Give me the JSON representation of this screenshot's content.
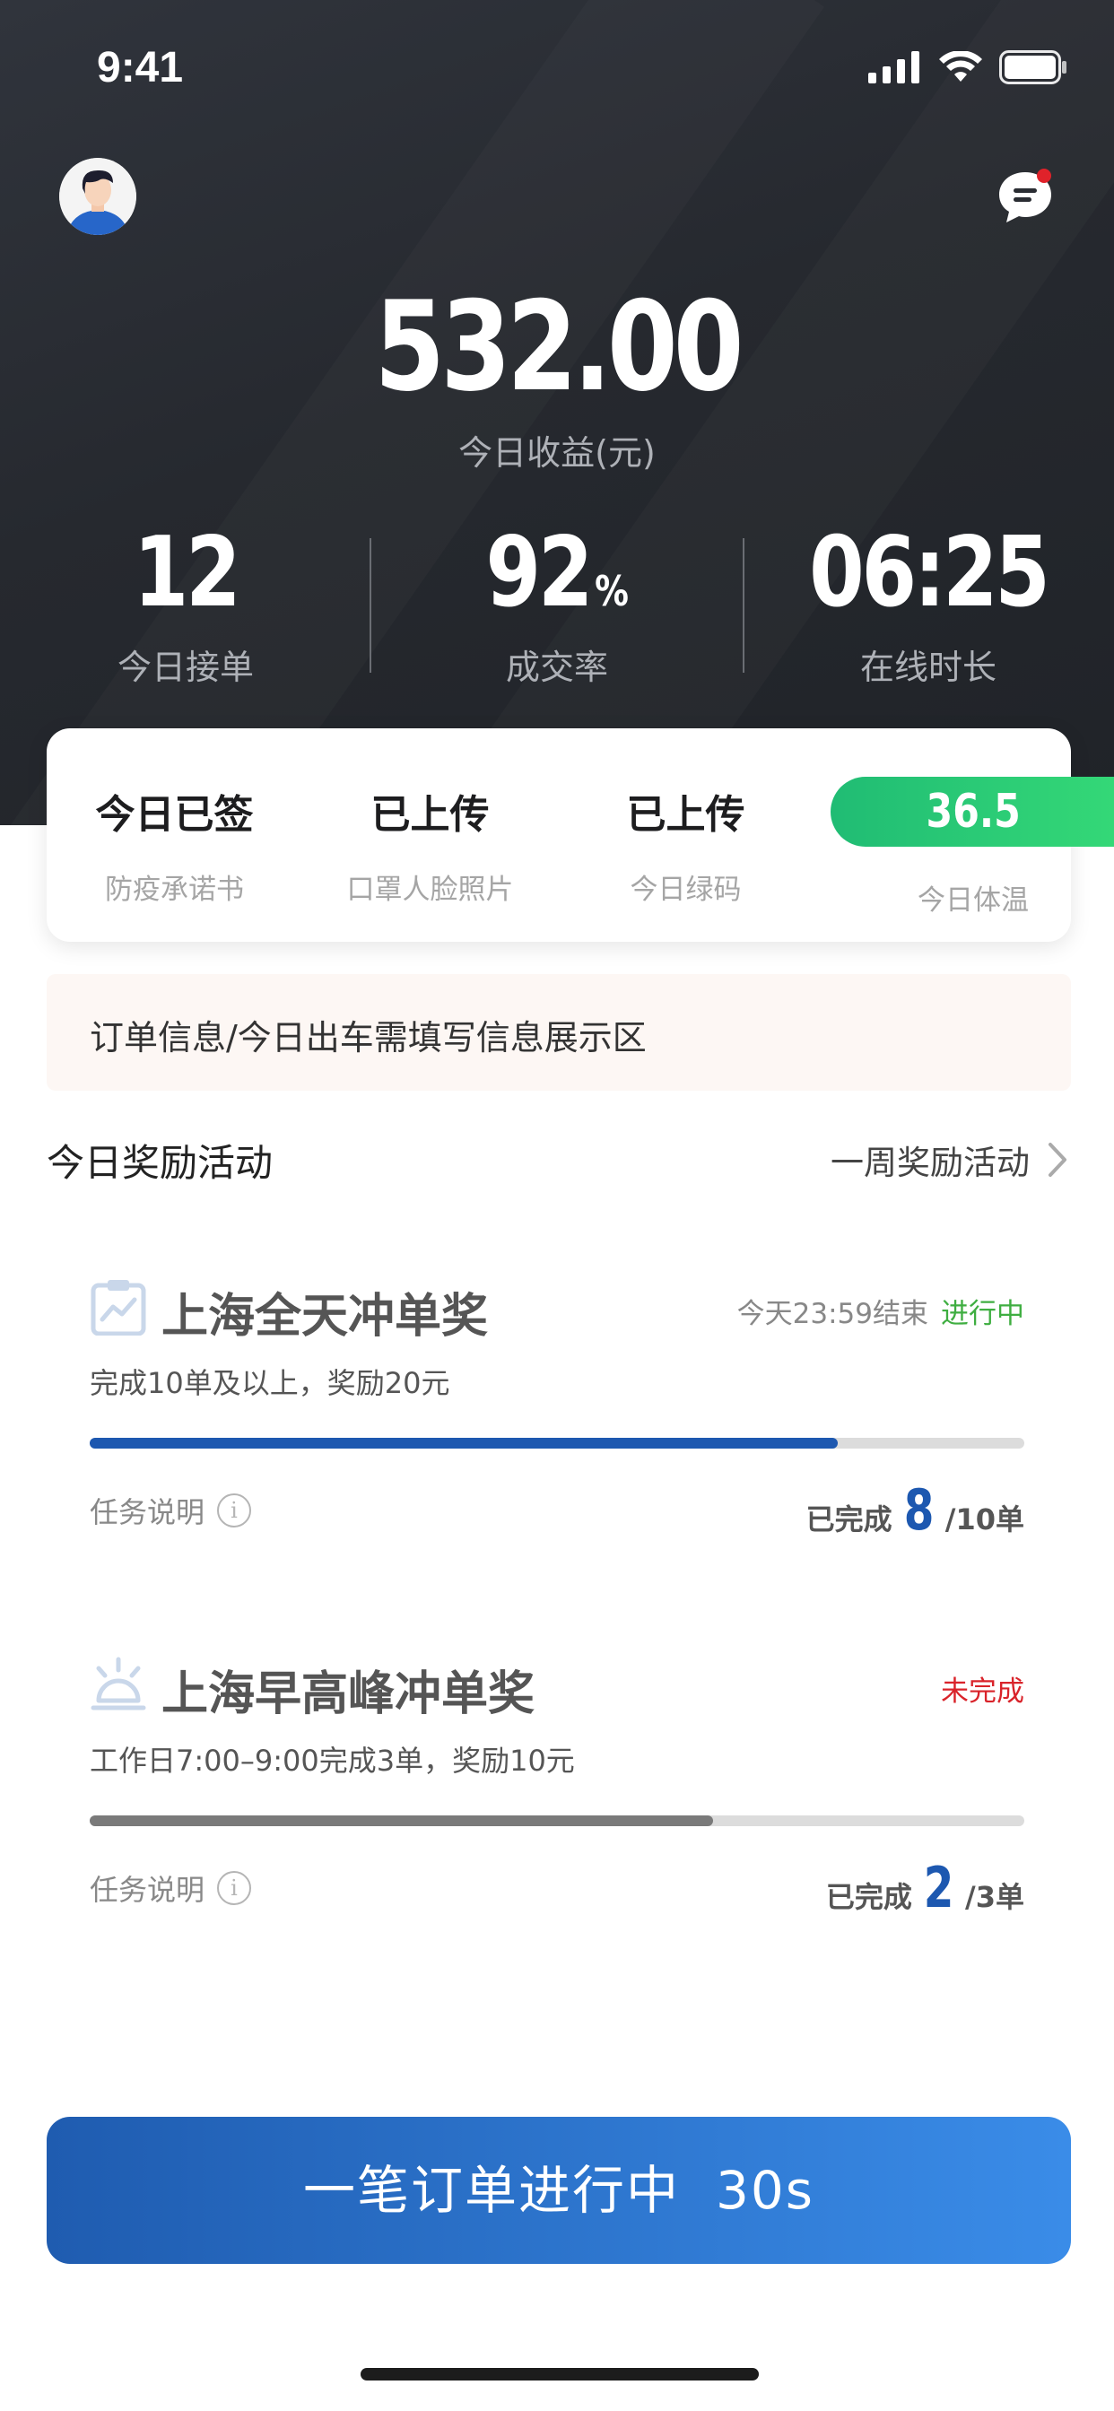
{
  "status_bar": {
    "time": "9:41"
  },
  "header": {
    "earnings_value": "532.00",
    "earnings_label": "今日收益(元)",
    "stats": [
      {
        "value": "12",
        "label": "今日接单"
      },
      {
        "value": "92",
        "unit": "%",
        "label": "成交率"
      },
      {
        "value": "06:25",
        "label": "在线时长"
      }
    ]
  },
  "status_card": {
    "items": [
      {
        "value": "今日已签",
        "label": "防疫承诺书"
      },
      {
        "value": "已上传",
        "label": "口罩人脸照片"
      },
      {
        "value": "已上传",
        "label": "今日绿码"
      }
    ],
    "temperature": {
      "value": "36.5",
      "label": "今日体温"
    }
  },
  "info_banner": {
    "text": "订单信息/今日出车需填写信息展示区"
  },
  "rewards": {
    "title": "今日奖励活动",
    "link_label": "一周奖励活动",
    "items": [
      {
        "icon": "chart-icon",
        "title": "上海全天冲单奖",
        "deadline": "今天23:59结束",
        "status": "进行中",
        "status_color": "#3fae41",
        "description": "完成10单及以上，奖励20元",
        "progress": 0.8,
        "progress_color": "#1d58b0",
        "note": "任务说明",
        "completed_prefix": "已完成",
        "completed": "8",
        "total": "/10单"
      },
      {
        "icon": "sunrise-icon",
        "title": "上海早高峰冲单奖",
        "deadline": "",
        "status": "未完成",
        "status_color": "#d9232a",
        "description": "工作日7:00–9:00完成3单，奖励10元",
        "progress": 0.667,
        "progress_color": "#7a7a7a",
        "note": "任务说明",
        "completed_prefix": "已完成",
        "completed": "2",
        "total": "/3单"
      }
    ]
  },
  "order_button": {
    "label": "一笔订单进行中",
    "timer": "30s"
  }
}
